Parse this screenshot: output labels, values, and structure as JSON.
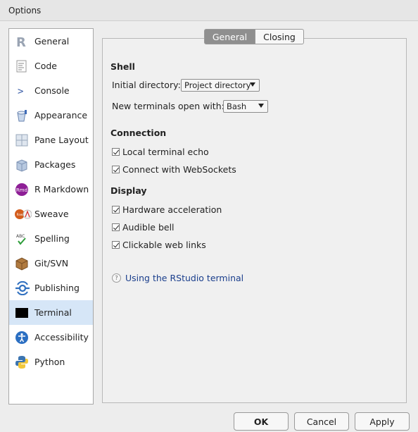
{
  "window": {
    "title": "Options"
  },
  "sidebar": {
    "items": [
      {
        "label": "General",
        "icon": "r-logo-icon"
      },
      {
        "label": "Code",
        "icon": "code-document-icon"
      },
      {
        "label": "Console",
        "icon": "console-prompt-icon"
      },
      {
        "label": "Appearance",
        "icon": "paint-bucket-icon"
      },
      {
        "label": "Pane Layout",
        "icon": "pane-layout-icon"
      },
      {
        "label": "Packages",
        "icon": "package-box-icon"
      },
      {
        "label": "R Markdown",
        "icon": "rmd-icon"
      },
      {
        "label": "Sweave",
        "icon": "sweave-icon"
      },
      {
        "label": "Spelling",
        "icon": "spelling-abc-icon"
      },
      {
        "label": "Git/SVN",
        "icon": "git-box-icon"
      },
      {
        "label": "Publishing",
        "icon": "publishing-icon"
      },
      {
        "label": "Terminal",
        "icon": "terminal-icon"
      },
      {
        "label": "Accessibility",
        "icon": "accessibility-icon"
      },
      {
        "label": "Python",
        "icon": "python-icon"
      }
    ],
    "selected": "Terminal"
  },
  "tabs": {
    "general": "General",
    "closing": "Closing"
  },
  "shell": {
    "title": "Shell",
    "initial_directory_label": "Initial directory:",
    "initial_directory_value": "Project directory",
    "new_terminals_label": "New terminals open with:",
    "new_terminals_value": "Bash"
  },
  "connection": {
    "title": "Connection",
    "local_echo": "Local terminal echo",
    "websockets": "Connect with WebSockets"
  },
  "display": {
    "title": "Display",
    "hardware_acceleration": "Hardware acceleration",
    "audible_bell": "Audible bell",
    "clickable_links": "Clickable web links"
  },
  "help": {
    "icon_text": "?",
    "link": "Using the RStudio terminal"
  },
  "buttons": {
    "ok": "OK",
    "cancel": "Cancel",
    "apply": "Apply"
  },
  "colors": {
    "selected_bg": "#d6e6f7",
    "link": "#1a3e8c",
    "active_tab": "#8f8f8f"
  }
}
